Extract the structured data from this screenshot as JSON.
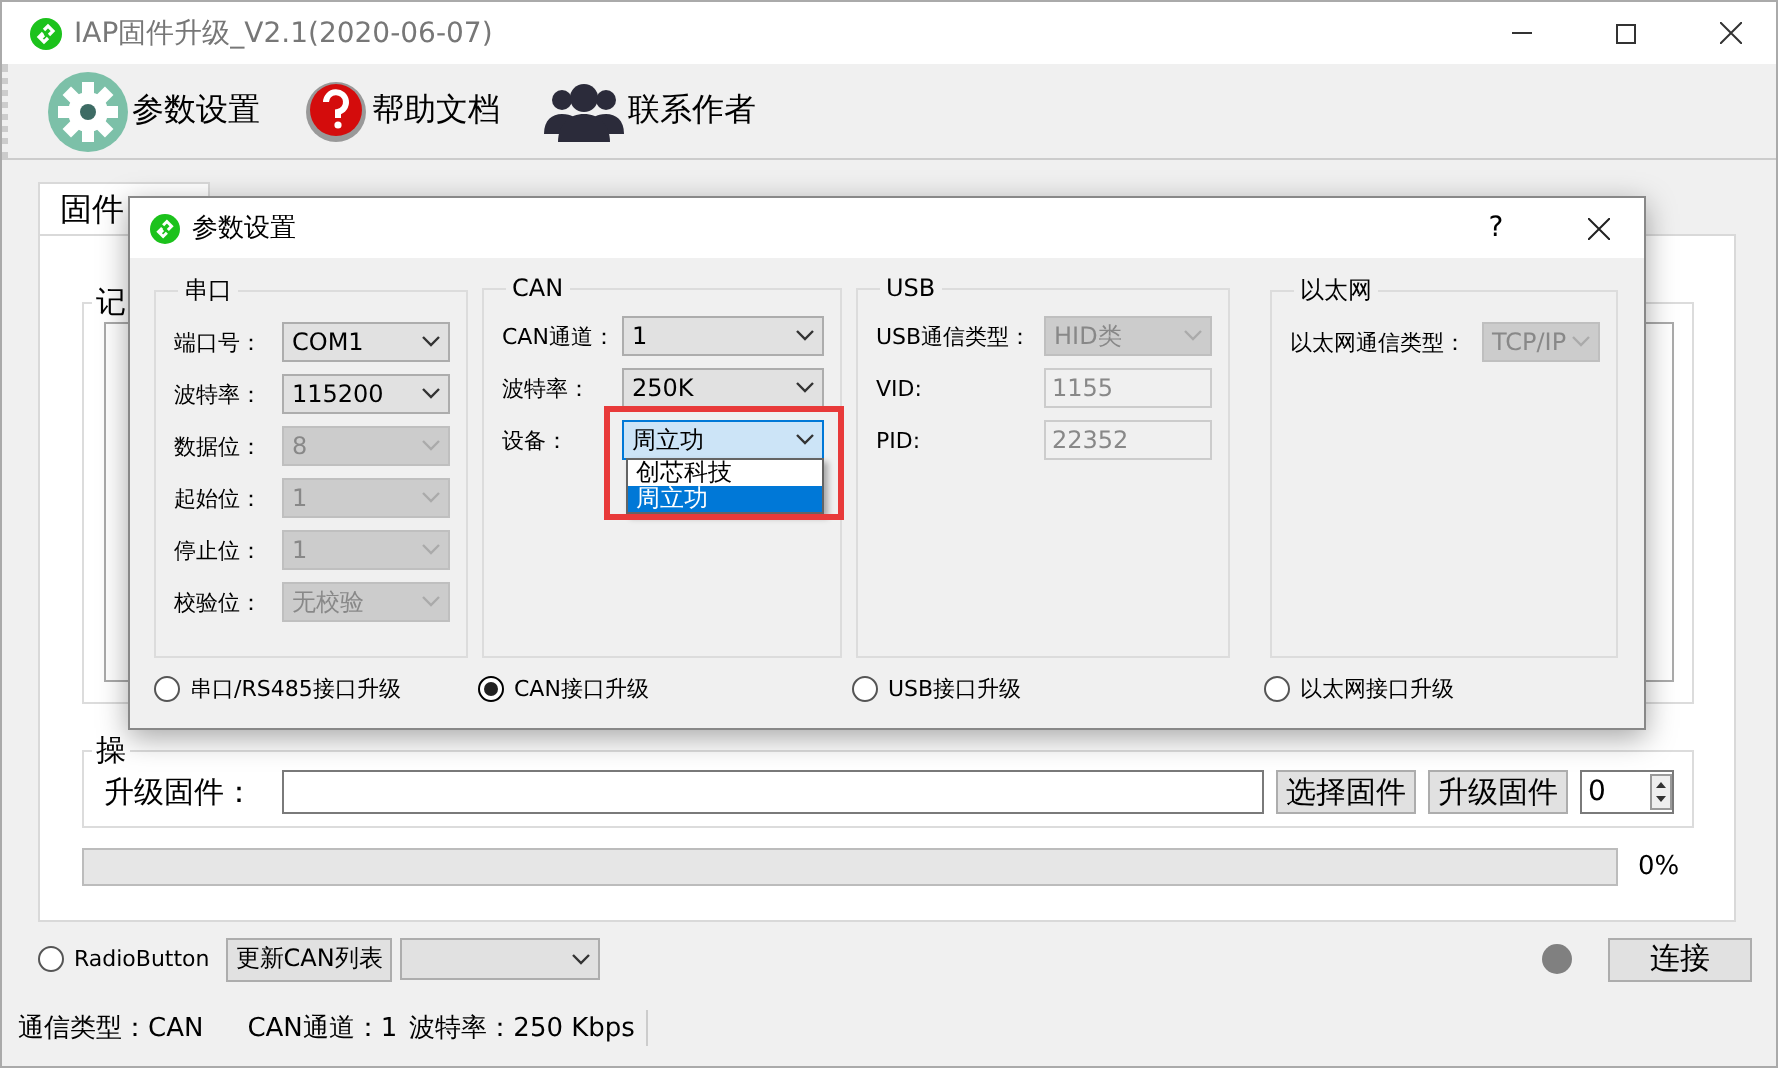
{
  "window": {
    "title": "IAP固件升级_V2.1(2020-06-07)"
  },
  "toolbar": [
    {
      "label": "参数设置",
      "kind": "gear"
    },
    {
      "label": "帮助文档",
      "kind": "help"
    },
    {
      "label": "联系作者",
      "kind": "people"
    }
  ],
  "tabs": [
    {
      "label": "固件",
      "selected": true
    }
  ],
  "log_group": {
    "title": "记"
  },
  "operation_group": {
    "title": "操",
    "label": "升级固件：",
    "buttons": [
      "选择固件",
      "升级固件"
    ],
    "spin_value": "0"
  },
  "progress": {
    "level": 0,
    "reading": "0%"
  },
  "bottom": {
    "radio": {
      "label": "RadioButton",
      "selected": false
    },
    "refresh_button": "更新CAN列表",
    "connect_button": "连接"
  },
  "status_bar": [
    "通信类型：CAN",
    "CAN通道：1",
    "波特率：250 Kbps"
  ],
  "dialog": {
    "title": "参数设置",
    "help": "?",
    "groups": [
      {
        "title": "串口",
        "fields": [
          {
            "label": "端口号：",
            "kind": "combo",
            "value": "COM1",
            "disabled": false
          },
          {
            "label": "波特率：",
            "kind": "combo",
            "value": "115200",
            "disabled": false
          },
          {
            "label": "数据位：",
            "kind": "combo",
            "value": "8",
            "disabled": true
          },
          {
            "label": "起始位：",
            "kind": "combo",
            "value": "1",
            "disabled": true
          },
          {
            "label": "停止位：",
            "kind": "combo",
            "value": "1",
            "disabled": true
          },
          {
            "label": "校验位：",
            "kind": "combo",
            "value": "无校验",
            "disabled": true
          }
        ]
      },
      {
        "title": "CAN",
        "fields": [
          {
            "label": "CAN通道：",
            "kind": "combo",
            "value": "1",
            "disabled": false
          },
          {
            "label": "波特率：",
            "kind": "combo",
            "value": "250K",
            "disabled": false
          },
          {
            "label": "设备：",
            "kind": "combo",
            "value": "周立功",
            "disabled": false,
            "expanded": true,
            "highlighted": true,
            "options": [
              {
                "label": "创芯科技",
                "selected": false
              },
              {
                "label": "周立功",
                "selected": true
              }
            ]
          }
        ]
      },
      {
        "title": "USB",
        "fields": [
          {
            "label": "USB通信类型：",
            "kind": "combo",
            "value": "HID类",
            "disabled": true
          },
          {
            "label": "VID:",
            "kind": "text",
            "value": "1155",
            "disabled": true
          },
          {
            "label": "PID:",
            "kind": "text",
            "value": "22352",
            "disabled": true
          }
        ]
      },
      {
        "title": "以太网",
        "fields": [
          {
            "label": "以太网通信类型：",
            "kind": "combo",
            "value": "TCP/IP",
            "disabled": true
          }
        ]
      }
    ],
    "radios": [
      {
        "label": "串口/RS485接口升级",
        "selected": false
      },
      {
        "label": "CAN接口升级",
        "selected": true
      },
      {
        "label": "USB接口升级",
        "selected": false
      },
      {
        "label": "以太网接口升级",
        "selected": false
      }
    ]
  }
}
